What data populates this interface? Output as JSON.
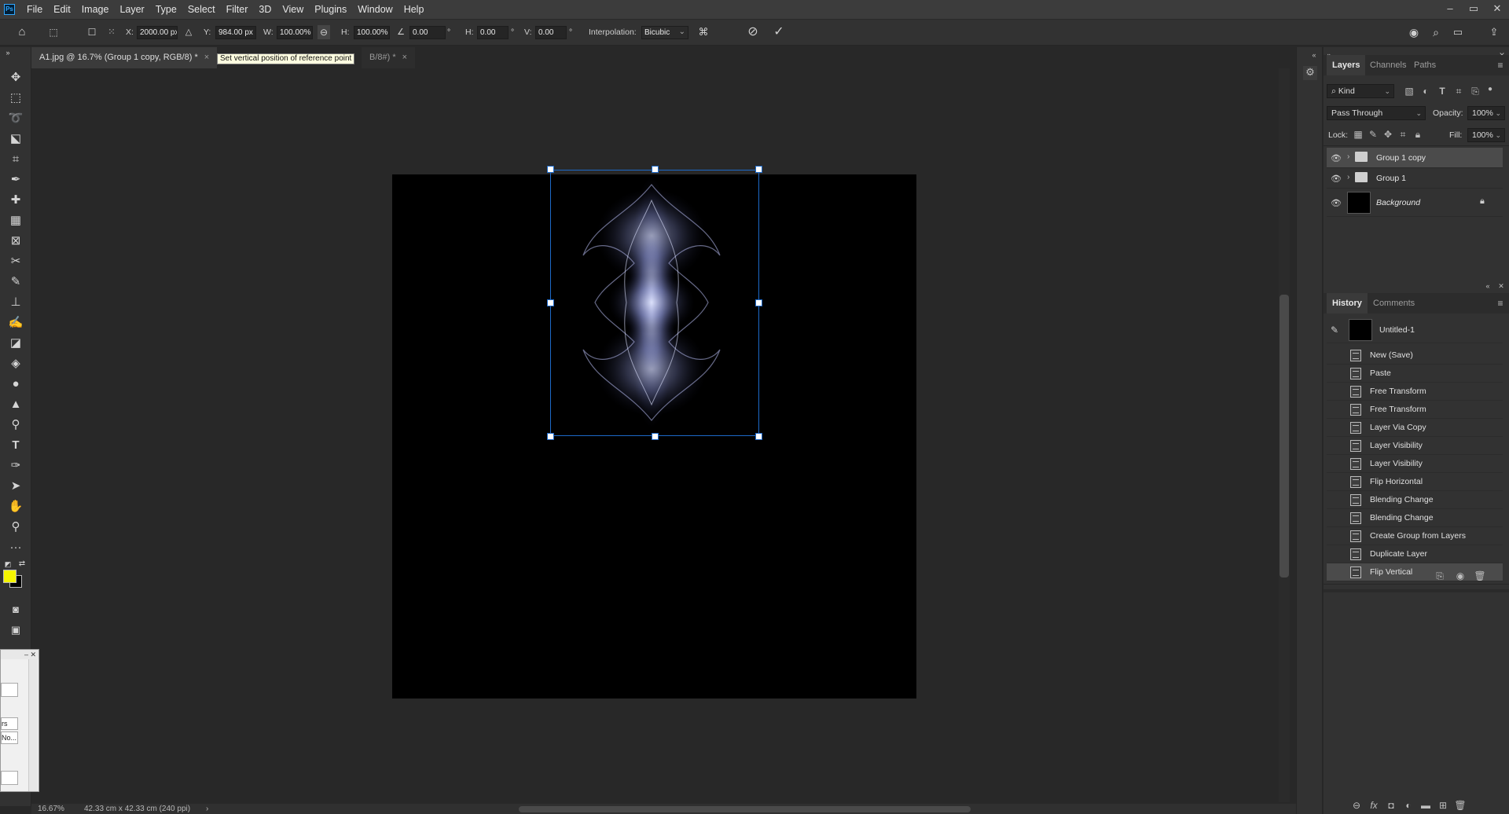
{
  "menu": {
    "items": [
      "File",
      "Edit",
      "Image",
      "Layer",
      "Type",
      "Select",
      "Filter",
      "3D",
      "View",
      "Plugins",
      "Window",
      "Help"
    ],
    "window_controls": [
      "–",
      "▭",
      "✕"
    ]
  },
  "options": {
    "x_label": "X:",
    "x_value": "2000.00 px",
    "y_label": "Y:",
    "y_value": "984.00 px",
    "w_label": "W:",
    "w_value": "100.00%",
    "h_label": "H:",
    "h_value": "100.00%",
    "angle_value": "0.00",
    "angle_unit": "°",
    "hskew_label": "H:",
    "hskew_value": "0.00",
    "vskew_label": "V:",
    "vskew_value": "0.00",
    "skew_unit": "°",
    "interp_label": "Interpolation:",
    "interp_value": "Bicubic"
  },
  "tabs": [
    {
      "label": "A1.jpg @ 16.7% (Group 1 copy, RGB/8) *",
      "close": "×"
    },
    {
      "label": "B/8#) *",
      "close": "×"
    }
  ],
  "tooltip": "Set vertical position of reference point",
  "status": {
    "zoom": "16.67%",
    "doc_size": "42.33 cm x 42.33 cm (240 ppi)",
    "arrow": "›"
  },
  "layers_panel": {
    "tabs": [
      "Layers",
      "Channels",
      "Paths"
    ],
    "filter": "Kind",
    "blend_mode": "Pass Through",
    "opacity_label": "Opacity:",
    "opacity_value": "100%",
    "lock_label": "Lock:",
    "fill_label": "Fill:",
    "fill_value": "100%",
    "layers": [
      {
        "name": "Group 1 copy",
        "selected": true
      },
      {
        "name": "Group 1",
        "selected": false
      },
      {
        "name": "Background",
        "selected": false
      }
    ]
  },
  "history_panel": {
    "tabs": [
      "History",
      "Comments"
    ],
    "snapshot": "Untitled-1",
    "items": [
      "New (Save)",
      "Paste",
      "Free Transform",
      "Free Transform",
      "Layer Via Copy",
      "Layer Visibility",
      "Layer Visibility",
      "Flip Horizontal",
      "Blending Change",
      "Blending Change",
      "Create Group from Layers",
      "Duplicate Layer",
      "Flip Vertical"
    ],
    "selected_index": 12
  },
  "mini_dialog": {
    "line1": "rs",
    "line2": "No..."
  },
  "colors": {
    "foreground": "#f5f500",
    "background": "#000000",
    "selection": "#1d69c8"
  }
}
